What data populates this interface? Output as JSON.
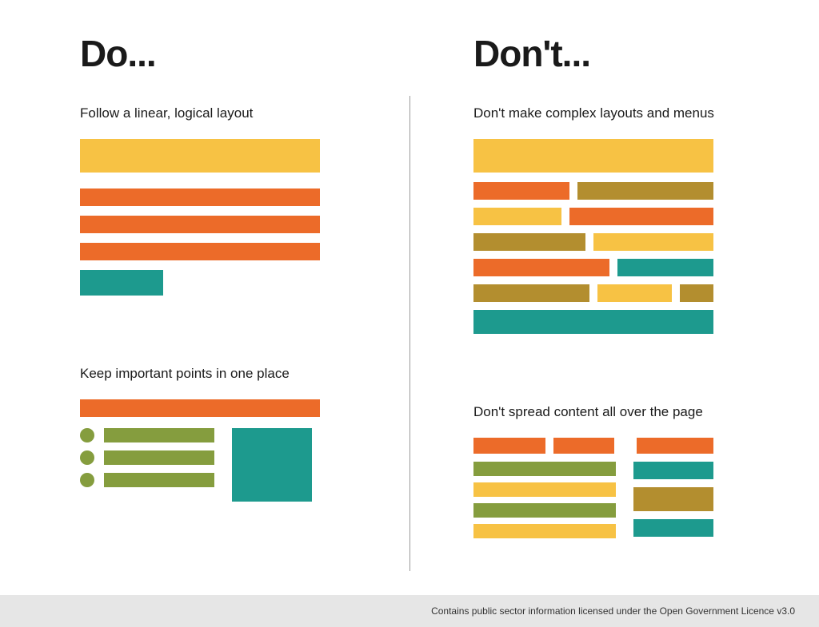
{
  "headings": {
    "do": "Do...",
    "dont": "Don't..."
  },
  "do": {
    "section1": "Follow a linear, logical layout",
    "section2": "Keep important points in one place"
  },
  "dont": {
    "section1": "Don't make complex layouts and menus",
    "section2": "Don't spread content all over the page"
  },
  "footer": "Contains public sector information licensed under the Open Government Licence v3.0",
  "colors": {
    "yellow": "#F7C244",
    "orange": "#EC6B29",
    "teal": "#1D9A8E",
    "olive": "#859D3E",
    "brown": "#B38E2F"
  }
}
